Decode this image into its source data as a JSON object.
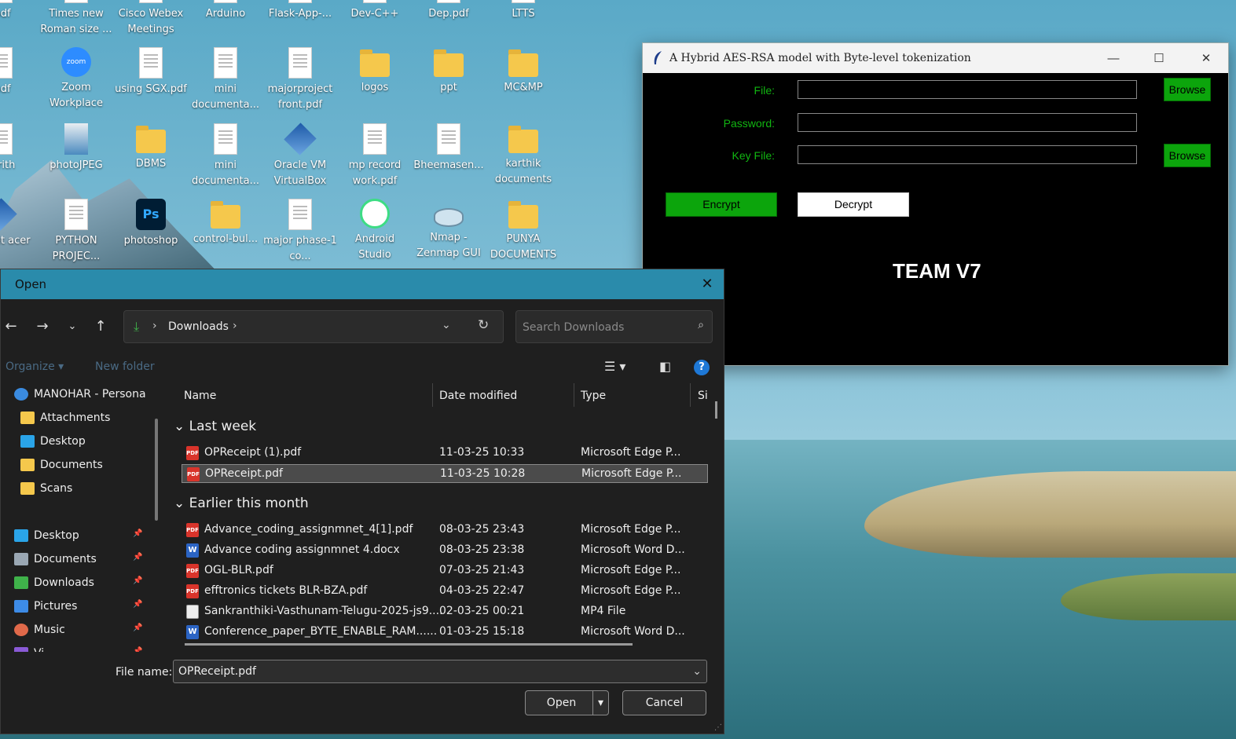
{
  "desktop": {
    "icons": [
      {
        "label": ".pdf",
        "type": "doc"
      },
      {
        "label": "Times new Roman size ...",
        "type": "doc"
      },
      {
        "label": "Cisco Webex Meetings",
        "type": "doc"
      },
      {
        "label": "Arduino",
        "type": "doc"
      },
      {
        "label": "Flask-App-...",
        "type": "doc"
      },
      {
        "label": "Dev-C++",
        "type": "doc"
      },
      {
        "label": "Dep.pdf",
        "type": "doc"
      },
      {
        "label": "LTTS",
        "type": "doc"
      },
      {
        "label": ".pdf",
        "type": "doc"
      },
      {
        "label": "Zoom Workplace",
        "type": "zoom"
      },
      {
        "label": "using SGX.pdf",
        "type": "doc"
      },
      {
        "label": "mini documenta...",
        "type": "doc"
      },
      {
        "label": "majorproject front.pdf",
        "type": "doc"
      },
      {
        "label": "logos",
        "type": "folder"
      },
      {
        "label": "ppt",
        "type": "folder"
      },
      {
        "label": "MC&MP",
        "type": "folder"
      },
      {
        "label": "_arith",
        "type": "doc"
      },
      {
        "label": "photoJPEG",
        "type": "photo"
      },
      {
        "label": "DBMS",
        "type": "folder"
      },
      {
        "label": "mini documenta...",
        "type": "doc"
      },
      {
        "label": "Oracle VM VirtualBox",
        "type": "box3d"
      },
      {
        "label": "mp record work.pdf",
        "type": "doc"
      },
      {
        "label": "Bheemasen...",
        "type": "doc"
      },
      {
        "label": "karthik documents",
        "type": "folder"
      },
      {
        "label": "Packet acer",
        "type": "box3d"
      },
      {
        "label": "PYTHON PROJEC...",
        "type": "doc"
      },
      {
        "label": "photoshop",
        "type": "ps"
      },
      {
        "label": "control-bul...",
        "type": "folder"
      },
      {
        "label": "major phase-1 co...",
        "type": "doc"
      },
      {
        "label": "Android Studio",
        "type": "android"
      },
      {
        "label": "Nmap - Zenmap GUI",
        "type": "eye"
      },
      {
        "label": "PUNYA DOCUMENTS",
        "type": "folder"
      }
    ]
  },
  "aes_window": {
    "title": "A Hybrid AES-RSA model with Byte-level tokenization",
    "file_label": "File:",
    "password_label": "Password:",
    "keyfile_label": "Key File:",
    "browse_label": "Browse",
    "browse2_label": "Browse",
    "encrypt_label": "Encrypt",
    "decrypt_label": "Decrypt",
    "team_label": "TEAM V7",
    "minimize": "—",
    "maximize": "☐",
    "close": "✕",
    "accent": "#0ca50c"
  },
  "open_dialog": {
    "title": "Open",
    "close": "✕",
    "address": {
      "crumb": "Downloads",
      "sep": "›"
    },
    "search": {
      "placeholder": "Search Downloads"
    },
    "toolbar": {
      "organize": "Organize ▾",
      "new_folder": "New folder",
      "help": "?"
    },
    "nav": [
      {
        "label": "MANOHAR - Persona",
        "icon": "cloud-icon",
        "pinned": false
      },
      {
        "label": "Attachments",
        "icon": "folder-icon",
        "pinned": false
      },
      {
        "label": "Desktop",
        "icon": "desktop-icon",
        "pinned": false
      },
      {
        "label": "Documents",
        "icon": "folder-icon",
        "pinned": false
      },
      {
        "label": "Scans",
        "icon": "folder-icon",
        "pinned": false
      },
      {
        "label": "Desktop",
        "icon": "desktop-icon",
        "pinned": true
      },
      {
        "label": "Documents",
        "icon": "documents-icon",
        "pinned": true
      },
      {
        "label": "Downloads",
        "icon": "download-icon",
        "pinned": true
      },
      {
        "label": "Pictures",
        "icon": "pictures-icon",
        "pinned": true
      },
      {
        "label": "Music",
        "icon": "music-icon",
        "pinned": true
      },
      {
        "label": "Vi...",
        "icon": "videos-icon",
        "pinned": true
      }
    ],
    "columns": {
      "name": "Name",
      "date": "Date modified",
      "type": "Type",
      "size": "Si"
    },
    "groups": [
      {
        "label": "Last week",
        "files": [
          {
            "name": "OPReceipt (1).pdf",
            "date": "11-03-25 10:33",
            "type": "Microsoft Edge P...",
            "kind": "pdf",
            "selected": false
          },
          {
            "name": "OPReceipt.pdf",
            "date": "11-03-25 10:28",
            "type": "Microsoft Edge P...",
            "kind": "pdf",
            "selected": true
          }
        ]
      },
      {
        "label": "Earlier this month",
        "files": [
          {
            "name": "Advance_coding_assignmnet_4[1].pdf",
            "date": "08-03-25 23:43",
            "type": "Microsoft Edge P...",
            "kind": "pdf",
            "selected": false
          },
          {
            "name": "Advance coding assignmnet 4.docx",
            "date": "08-03-25 23:38",
            "type": "Microsoft Word D...",
            "kind": "word",
            "selected": false
          },
          {
            "name": "OGL-BLR.pdf",
            "date": "07-03-25 21:43",
            "type": "Microsoft Edge P...",
            "kind": "pdf",
            "selected": false
          },
          {
            "name": "efftronics tickets BLR-BZA.pdf",
            "date": "04-03-25 22:47",
            "type": "Microsoft Edge P...",
            "kind": "pdf",
            "selected": false
          },
          {
            "name": "Sankranthiki-Vasthunam-Telugu-2025-js9....",
            "date": "02-03-25 00:21",
            "type": "MP4 File",
            "kind": "video",
            "selected": false
          },
          {
            "name": "Conference_paper_BYTE_ENABLE_RAM......",
            "date": "01-03-25 15:18",
            "type": "Microsoft Word D...",
            "kind": "word",
            "selected": false
          }
        ]
      }
    ],
    "filename_label": "File name:",
    "filename_value": "OPReceipt.pdf",
    "open_label": "Open",
    "cancel_label": "Cancel",
    "pdf_icon_text": "PDF",
    "word_icon_text": "W"
  }
}
